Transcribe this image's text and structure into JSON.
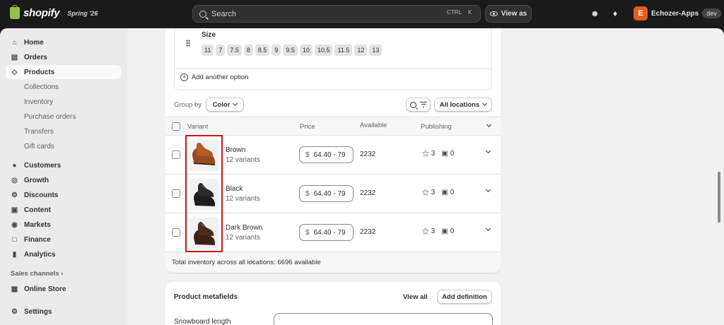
{
  "topbar": {
    "brand": "shopify",
    "edition": "Spring '26",
    "search_placeholder": "Search",
    "search_shortcut_1": "CTRL",
    "search_shortcut_2": "K",
    "view_as_label": "View as",
    "store_initial": "E",
    "store_name": "Echozer-Apps",
    "store_badge": "dev"
  },
  "sidebar": {
    "items": [
      {
        "label": "Home"
      },
      {
        "label": "Orders"
      },
      {
        "label": "Products"
      },
      {
        "label": "Customers"
      },
      {
        "label": "Growth"
      },
      {
        "label": "Discounts"
      },
      {
        "label": "Content"
      },
      {
        "label": "Markets"
      },
      {
        "label": "Finance"
      },
      {
        "label": "Analytics"
      },
      {
        "label": "Online Store"
      },
      {
        "label": "Settings"
      }
    ],
    "product_subitems": [
      "Collections",
      "Inventory",
      "Purchase orders",
      "Transfers",
      "Gift cards"
    ],
    "sales_channels_label": "Sales channels"
  },
  "options": {
    "name": "Size",
    "values": [
      "11",
      "7",
      "7.5",
      "8",
      "8.5",
      "9",
      "9.5",
      "10",
      "10.5",
      "11.5",
      "12",
      "13"
    ],
    "add_option_label": "Add another option"
  },
  "variants_toolbar": {
    "group_by_label": "Group by",
    "group_by_value": "Color",
    "locations_label": "All locations"
  },
  "table": {
    "headers": {
      "variant": "Variant",
      "price": "Price",
      "available": "Available",
      "publishing": "Publishing"
    },
    "rows": [
      {
        "name": "Brown",
        "variants": "12 variants",
        "currency": "$",
        "price": "64.40 - 79",
        "available": "2232",
        "pub_a": "3",
        "pub_b": "0"
      },
      {
        "name": "Black",
        "variants": "12 variants",
        "currency": "$",
        "price": "64.40 - 79",
        "available": "2232",
        "pub_a": "3",
        "pub_b": "0"
      },
      {
        "name": "Dark Brown",
        "variants": "12 variants",
        "currency": "$",
        "price": "64.40 - 79",
        "available": "2232",
        "pub_a": "3",
        "pub_b": "0"
      }
    ],
    "footer": "Total inventory across all locations: 6696 available"
  },
  "metafields": {
    "title": "Product metafields",
    "view_all": "View all",
    "add_definition": "Add definition",
    "field_label": "Snowboard length"
  },
  "colors": {
    "highlight": "#d0141a",
    "brown_shoe": "#9a4a1c",
    "black_shoe": "#1c1c1c",
    "dark_brown_shoe": "#3d2217"
  }
}
